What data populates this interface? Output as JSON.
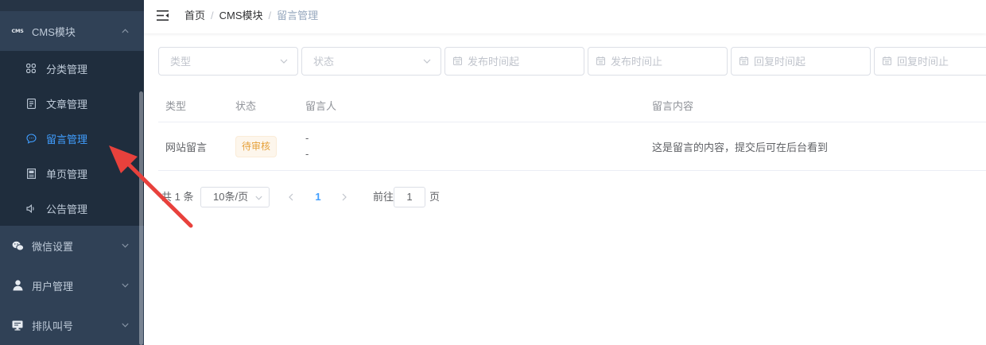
{
  "sidebar": {
    "groups": {
      "cms": {
        "label": "CMS模块",
        "icon": "cms-icon",
        "icon_text": "CMS",
        "expanded": true,
        "items": [
          {
            "label": "分类管理",
            "icon": "grid-icon"
          },
          {
            "label": "文章管理",
            "icon": "document-icon"
          },
          {
            "label": "留言管理",
            "icon": "chat-bubble-icon",
            "active": true
          },
          {
            "label": "单页管理",
            "icon": "page-icon"
          },
          {
            "label": "公告管理",
            "icon": "speaker-icon"
          }
        ]
      },
      "wechat": {
        "label": "微信设置",
        "icon": "wechat-icon",
        "expanded": false
      },
      "users": {
        "label": "用户管理",
        "icon": "user-icon",
        "expanded": false
      },
      "queue": {
        "label": "排队叫号",
        "icon": "monitor-icon",
        "expanded": false
      }
    }
  },
  "navbar": {
    "toggle_icon": "hamburger-fold-icon",
    "breadcrumb": [
      "首页",
      "CMS模块",
      "留言管理"
    ],
    "separator": "/"
  },
  "filters": {
    "type": {
      "placeholder": "类型",
      "icon": "chevron-down-icon"
    },
    "status": {
      "placeholder": "状态",
      "icon": "chevron-down-icon"
    },
    "publish_start": {
      "placeholder": "发布时间起",
      "icon": "calendar-icon"
    },
    "publish_end": {
      "placeholder": "发布时间止",
      "icon": "calendar-icon"
    },
    "reply_start": {
      "placeholder": "回复时间起",
      "icon": "calendar-icon"
    },
    "reply_end": {
      "placeholder": "回复时间止",
      "icon": "calendar-icon"
    }
  },
  "table": {
    "columns": [
      "类型",
      "状态",
      "留言人",
      "留言内容"
    ],
    "rows": [
      {
        "type": "网站留言",
        "status": "待审核",
        "sender_name": "-",
        "sender_contact": "-",
        "content": "这是留言的内容，提交后可在后台看到"
      }
    ]
  },
  "pagination": {
    "total_text": "共 1 条",
    "page_size": "10条/页",
    "prev_icon": "chevron-left-icon",
    "current_page": "1",
    "next_icon": "chevron-right-icon",
    "goto_label": "前往",
    "goto_value": "1",
    "page_suffix": "页"
  },
  "colors": {
    "sidebar_bg": "#304156",
    "submenu_bg": "#1f2d3d",
    "sidebar_text": "#bfcbd9",
    "active": "#409eff",
    "warning_text": "#e6a23c",
    "warning_bg": "#fdf6ec",
    "warning_border": "#faecd8",
    "annotation_arrow": "#e8413c"
  }
}
